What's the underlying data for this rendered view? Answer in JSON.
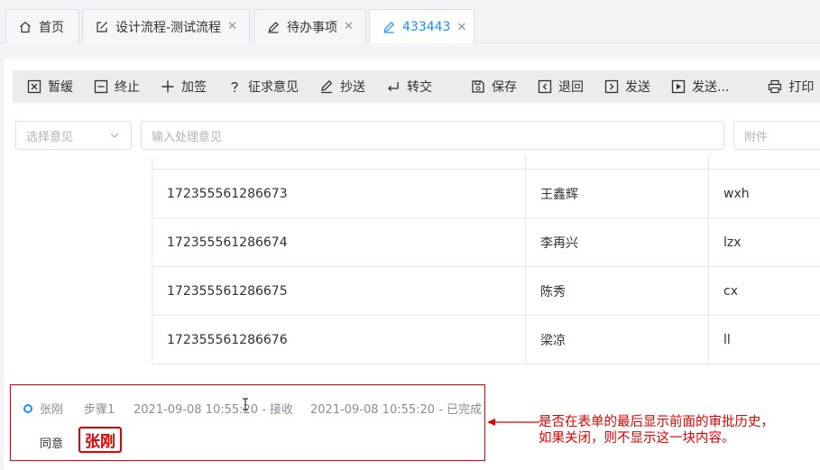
{
  "tabs": [
    {
      "label": "首页",
      "icon": "home-icon",
      "closable": false
    },
    {
      "label": "设计流程-测试流程",
      "icon": "edit-square-icon",
      "closable": true
    },
    {
      "label": "待办事项",
      "icon": "pen-icon",
      "closable": true
    },
    {
      "label": "433443",
      "icon": "pen-icon",
      "closable": true,
      "active": true
    }
  ],
  "toolbar": {
    "pause": "暂缓",
    "terminate": "终止",
    "add_sign": "加签",
    "solicit": "征求意见",
    "copy_send": "抄送",
    "transfer": "转交",
    "save": "保存",
    "return": "退回",
    "send": "发送",
    "send_more": "发送...",
    "print": "打印"
  },
  "opinion": {
    "select_placeholder": "选择意见",
    "input_placeholder": "输入处理意见",
    "attachment_placeholder": "附件"
  },
  "table": {
    "rows": [
      {
        "id": "172355561286673",
        "name": "王鑫辉",
        "code": "wxh"
      },
      {
        "id": "172355561286674",
        "name": "李再兴",
        "code": "lzx"
      },
      {
        "id": "172355561286675",
        "name": "陈秀",
        "code": "cx"
      },
      {
        "id": "172355561286676",
        "name": "梁凉",
        "code": "ll"
      }
    ]
  },
  "history": {
    "user": "张刚",
    "step": "步骤1",
    "received": "2021-09-08 10:55:20 - 接收",
    "completed": "2021-09-08 10:55:20 - 已完成",
    "opinion": "同意",
    "signature": "张刚"
  },
  "annotation": {
    "line1": "是否在表单的最后显示前面的审批历史，",
    "line2": "如果关闭，则不显示这一块内容。"
  },
  "colors": {
    "accent": "#1890ff",
    "annotation": "#e60000",
    "toolbar_bg": "#ececec"
  }
}
